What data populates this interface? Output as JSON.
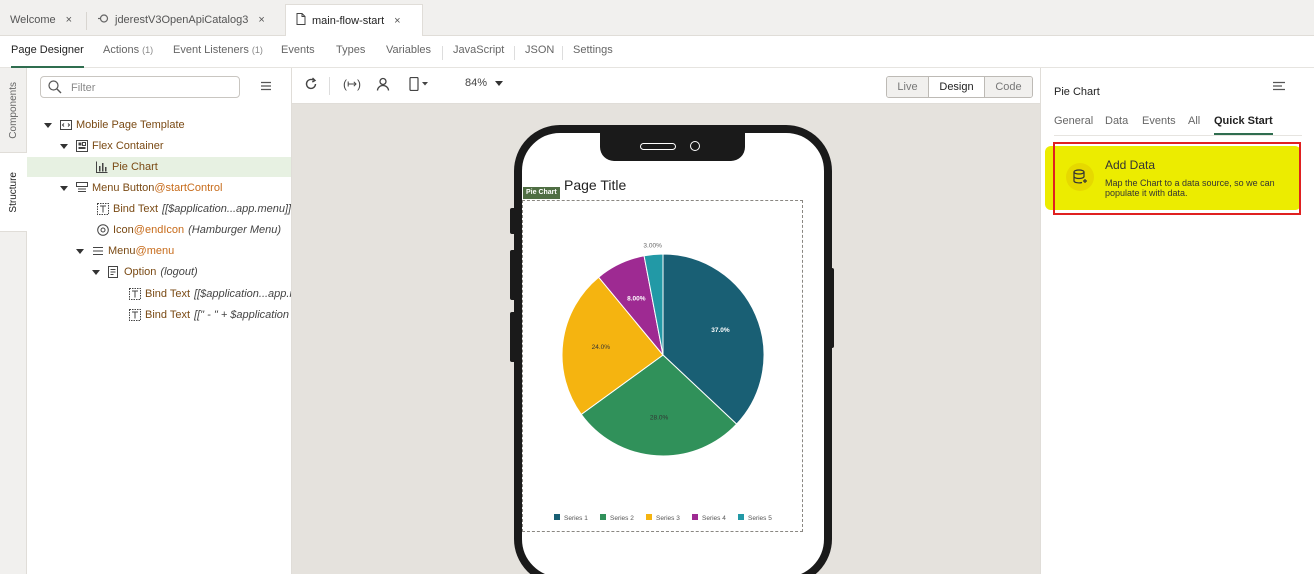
{
  "tabs": [
    {
      "label": "Welcome",
      "icon": "none",
      "active": false
    },
    {
      "label": "jderestV3OpenApiCatalog3",
      "icon": "api-icon",
      "active": false
    },
    {
      "label": "main-flow-start",
      "icon": "document-icon",
      "active": true
    }
  ],
  "tab_close": "×",
  "editor_nav": [
    {
      "label": "Page Designer",
      "count": ""
    },
    {
      "label": "Actions",
      "count": "(1)"
    },
    {
      "label": "Event Listeners",
      "count": "(1)"
    },
    {
      "label": "Events",
      "count": ""
    },
    {
      "label": "Types",
      "count": ""
    },
    {
      "label": "Variables",
      "count": ""
    },
    {
      "label": "JavaScript",
      "count": ""
    },
    {
      "label": "JSON",
      "count": ""
    },
    {
      "label": "Settings",
      "count": ""
    }
  ],
  "vertical_tabs": {
    "components": "Components",
    "structure": "Structure"
  },
  "filter": {
    "placeholder": "Filter"
  },
  "tree": [
    {
      "name": "Mobile Page Template",
      "ref": "",
      "arg": "",
      "depth": 0,
      "caret": true,
      "icon": "template-icon"
    },
    {
      "name": "Flex Container",
      "ref": "",
      "arg": "",
      "depth": 1,
      "caret": true,
      "icon": "flex-container-icon"
    },
    {
      "name": "Pie Chart",
      "ref": "",
      "arg": "",
      "depth": 2,
      "caret": false,
      "icon": "bar-chart-icon",
      "selected": true
    },
    {
      "name": "Menu Button",
      "ref": "@startControl",
      "arg": "",
      "depth": 1,
      "caret": true,
      "icon": "menu-button-icon"
    },
    {
      "name": "Bind Text",
      "ref": "",
      "arg": "[[$application...app.menu]]",
      "depth": 2,
      "caret": false,
      "icon": "bind-text-icon"
    },
    {
      "name": "Icon",
      "ref": "@endIcon",
      "arg": "(Hamburger Menu)",
      "depth": 2,
      "caret": false,
      "icon": "icon-icon"
    },
    {
      "name": "Menu",
      "ref": "@menu",
      "arg": "",
      "depth": 2,
      "caret": true,
      "icon": "menu-icon"
    },
    {
      "name": "Option",
      "ref": "",
      "arg": "(logout)",
      "depth": 3,
      "caret": true,
      "icon": "option-icon"
    },
    {
      "name": "Bind Text",
      "ref": "",
      "arg": "[[$application...app.i",
      "depth": 4,
      "caret": false,
      "icon": "bind-text-icon"
    },
    {
      "name": "Bind Text",
      "ref": "",
      "arg": "[[\" - \" + $application",
      "depth": 4,
      "caret": false,
      "icon": "bind-text-icon"
    }
  ],
  "canvas_toolbar": {
    "zoom": "84%",
    "modes": [
      "Live",
      "Design",
      "Code"
    ],
    "active_mode": "Design"
  },
  "phone": {
    "page_title": "Page Title",
    "chart_badge": "Pie Chart"
  },
  "chart_data": {
    "type": "pie",
    "title": "",
    "series": [
      {
        "name": "Series 1",
        "value": 37.0,
        "label": "37.0%",
        "color": "#195f74"
      },
      {
        "name": "Series 2",
        "value": 28.0,
        "label": "28.0%",
        "color": "#30915a"
      },
      {
        "name": "Series 3",
        "value": 24.0,
        "label": "24.0%",
        "color": "#f5b410"
      },
      {
        "name": "Series 4",
        "value": 8.0,
        "label": "8.00%",
        "color": "#9e2a92"
      },
      {
        "name": "Series 5",
        "value": 3.0,
        "label": "3.00%",
        "color": "#2299a6"
      }
    ],
    "legend": "bottom"
  },
  "props": {
    "title": "Pie Chart",
    "tabs": [
      "General",
      "Data",
      "Events",
      "All",
      "Quick Start"
    ],
    "active_tab": "Quick Start",
    "add_data": {
      "title": "Add Data",
      "desc": "Map the Chart to a data source, so we can populate it with data."
    }
  },
  "colors": {
    "accent": "#2f6d4f",
    "highlight": "#ecec00",
    "outline": "#e02020"
  }
}
